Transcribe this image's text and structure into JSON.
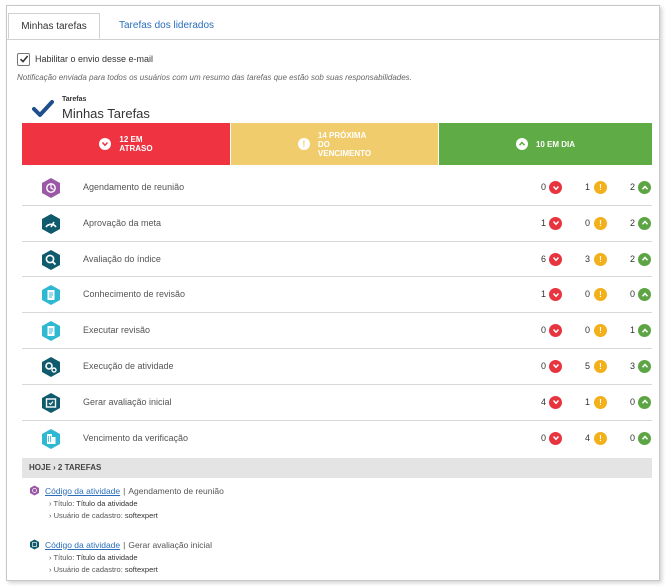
{
  "tabs": [
    "Minhas tarefas",
    "Tarefas dos liderados"
  ],
  "checkbox": {
    "label": "Habilitar o envio desse e-mail",
    "checked": true
  },
  "notification": "Notificação enviada para todos os usuários com um resumo das tarefas que estão sob suas responsabilidades.",
  "section": {
    "small_title": "Tarefas",
    "title": "Minhas Tarefas"
  },
  "status": {
    "late": {
      "line1": "12 EM",
      "line2": "ATRASO",
      "color": "#ef3340"
    },
    "due_soon": {
      "line1": "14 PRÓXIMA",
      "line2": "DO",
      "line3": "VENCIMENTO",
      "color": "#f0cc6d"
    },
    "on_time": {
      "line1": "10 EM DIA",
      "color": "#5fac46"
    }
  },
  "tasks": [
    {
      "label": "Agendamento de reunião",
      "late": "0",
      "soon": "1",
      "ok": "2",
      "icon": "meeting-icon",
      "color": "#9b58a6"
    },
    {
      "label": "Aprovação da meta",
      "late": "1",
      "soon": "0",
      "ok": "2",
      "icon": "gauge-icon",
      "color": "#0f5b6d"
    },
    {
      "label": "Avaliação do índice",
      "late": "6",
      "soon": "3",
      "ok": "2",
      "icon": "search-icon",
      "color": "#0f5b6d"
    },
    {
      "label": "Conhecimento de revisão",
      "late": "1",
      "soon": "0",
      "ok": "0",
      "icon": "document-icon",
      "color": "#2fb8d2"
    },
    {
      "label": "Executar revisão",
      "late": "0",
      "soon": "0",
      "ok": "1",
      "icon": "document-icon",
      "color": "#2fb8d2"
    },
    {
      "label": "Execução de atividade",
      "late": "0",
      "soon": "5",
      "ok": "3",
      "icon": "gears-icon",
      "color": "#0f5b6d"
    },
    {
      "label": "Gerar avaliação inicial",
      "late": "4",
      "soon": "1",
      "ok": "0",
      "icon": "clipboard-icon",
      "color": "#0f5b6d"
    },
    {
      "label": "Vencimento da verificação",
      "late": "0",
      "soon": "4",
      "ok": "0",
      "icon": "building-icon",
      "color": "#2fb8d2"
    }
  ],
  "today": {
    "header": "HOJE › 2 TAREFAS",
    "items": [
      {
        "link": "Código da atividade",
        "type": "Agendamento de reunião",
        "title_label": "› Título:",
        "title_value": "Título da atividade",
        "user_label": "› Usuário de cadastro:",
        "user_value": "softexpert",
        "icon": "meeting-icon"
      },
      {
        "link": "Código da atividade",
        "type": "Gerar avaliação inicial",
        "title_label": "› Título:",
        "title_value": "Título da atividade",
        "user_label": "› Usuário de cadastro:",
        "user_value": "softexpert",
        "icon": "clipboard-icon"
      }
    ]
  }
}
